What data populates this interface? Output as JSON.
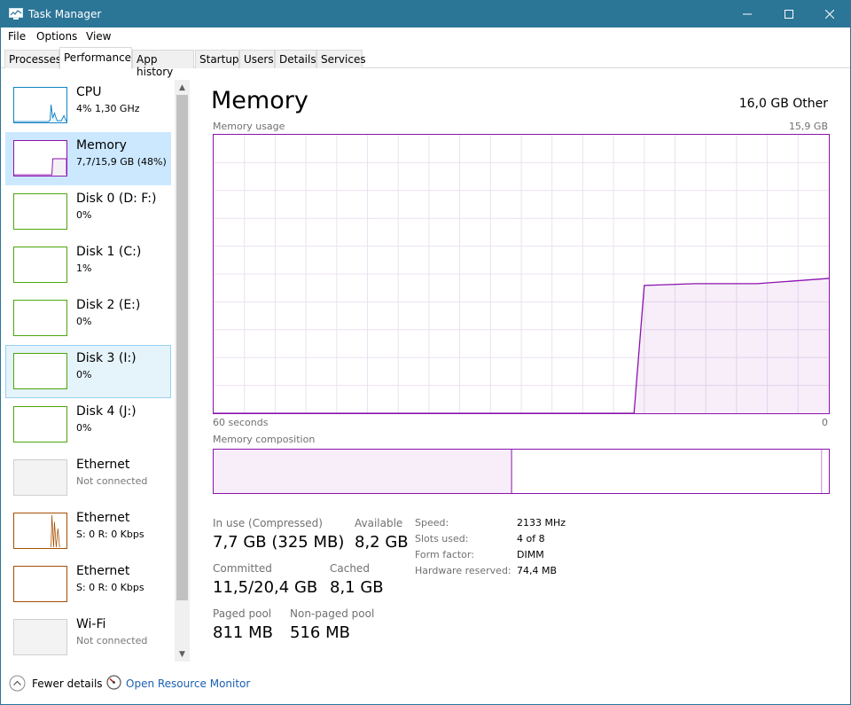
{
  "window": {
    "title": "Task Manager"
  },
  "menu": [
    "File",
    "Options",
    "View"
  ],
  "tabs": [
    "Processes",
    "Performance",
    "App history",
    "Startup",
    "Users",
    "Details",
    "Services"
  ],
  "sidebar": [
    {
      "name": "CPU",
      "sub": "4%  1,30 GHz"
    },
    {
      "name": "Memory",
      "sub": "7,7/15,9 GB (48%)"
    },
    {
      "name": "Disk 0 (D: F:)",
      "sub": "0%"
    },
    {
      "name": "Disk 1 (C:)",
      "sub": "1%"
    },
    {
      "name": "Disk 2 (E:)",
      "sub": "0%"
    },
    {
      "name": "Disk 3 (I:)",
      "sub": "0%"
    },
    {
      "name": "Disk 4 (J:)",
      "sub": "0%"
    },
    {
      "name": "Ethernet",
      "sub": "Not connected"
    },
    {
      "name": "Ethernet",
      "sub": "S: 0  R: 0 Kbps"
    },
    {
      "name": "Ethernet",
      "sub": "S: 0  R: 0 Kbps"
    },
    {
      "name": "Wi-Fi",
      "sub": "Not connected"
    }
  ],
  "main": {
    "title": "Memory",
    "total": "16,0 GB Other",
    "usage_label": "Memory usage",
    "usage_max": "15,9 GB",
    "time_left": "60 seconds",
    "time_right": "0",
    "composition_label": "Memory composition"
  },
  "usage_history": {
    "ylim_gb": [
      0,
      15.9
    ],
    "x_seconds_ago": [
      60,
      19,
      18,
      13,
      7,
      0
    ],
    "y_gb": [
      0,
      0,
      7.3,
      7.4,
      7.4,
      7.7
    ]
  },
  "composition": {
    "in_use_gb": 7.7,
    "modified_gb": 0.0,
    "standby_gb": 8.1,
    "free_gb": 0.1,
    "total_gb": 15.9
  },
  "stats": {
    "in_use_label": "In use (Compressed)",
    "in_use": "7,7 GB (325 MB)",
    "available_label": "Available",
    "available": "8,2 GB",
    "committed_label": "Committed",
    "committed": "11,5/20,4 GB",
    "cached_label": "Cached",
    "cached": "8,1 GB",
    "paged_label": "Paged pool",
    "paged": "811 MB",
    "nonpaged_label": "Non-paged pool",
    "nonpaged": "516 MB"
  },
  "details": [
    {
      "label": "Speed:",
      "value": "2133 MHz"
    },
    {
      "label": "Slots used:",
      "value": "4 of 8"
    },
    {
      "label": "Form factor:",
      "value": "DIMM"
    },
    {
      "label": "Hardware reserved:",
      "value": "74,4 MB"
    }
  ],
  "footer": {
    "fewer": "Fewer details",
    "monitor": "Open Resource Monitor"
  },
  "colors": {
    "title_bar": "#2b7597",
    "memory": "#8b12ae",
    "cpu": "#1183c4",
    "disk": "#4da60c",
    "ethernet": "#a74f01",
    "selected": "#cce8ff"
  }
}
